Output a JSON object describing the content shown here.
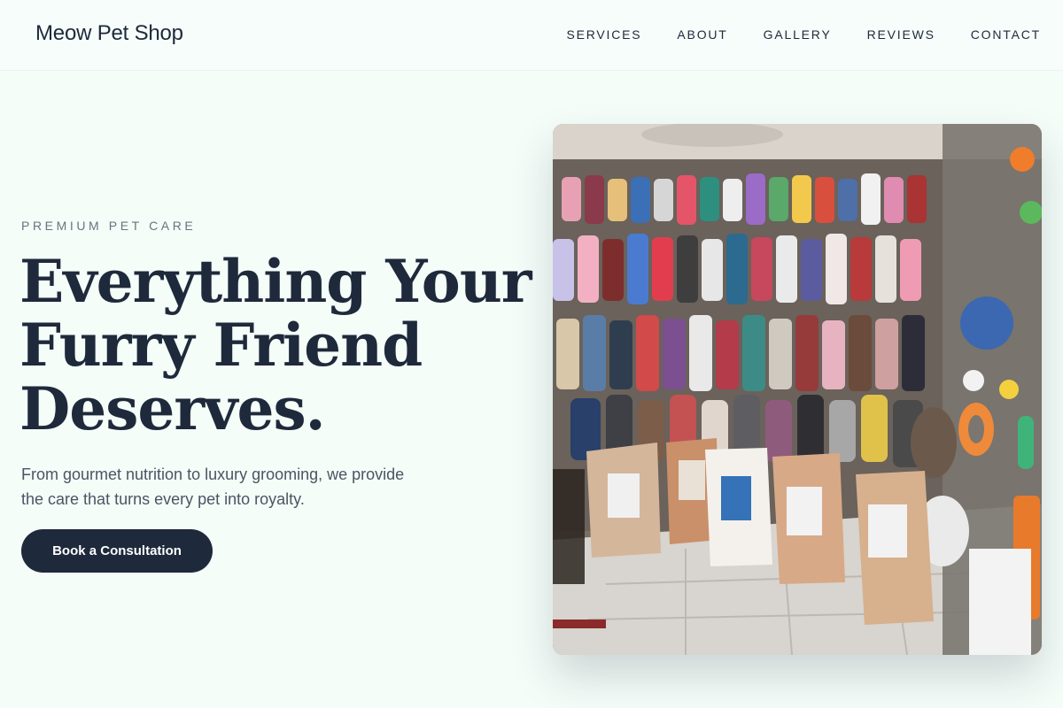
{
  "header": {
    "brand": "Meow Pet Shop",
    "nav": [
      "SERVICES",
      "ABOUT",
      "GALLERY",
      "REVIEWS",
      "CONTACT"
    ]
  },
  "hero": {
    "eyebrow": "PREMIUM PET CARE",
    "headline_lines": [
      "Everything Your",
      "Furry Friend",
      "Deserves."
    ],
    "lede": "From gourmet nutrition to luxury grooming, we provide the care that turns every pet into royalty.",
    "cta_label": "Book a Consultation",
    "image_alt": "Pet shop interior with hanging pet clothes, toys and food bags"
  },
  "colors": {
    "background": "#f4fdf8",
    "ink": "#1e293b",
    "muted": "#6b7280",
    "button": "#1e293b"
  }
}
